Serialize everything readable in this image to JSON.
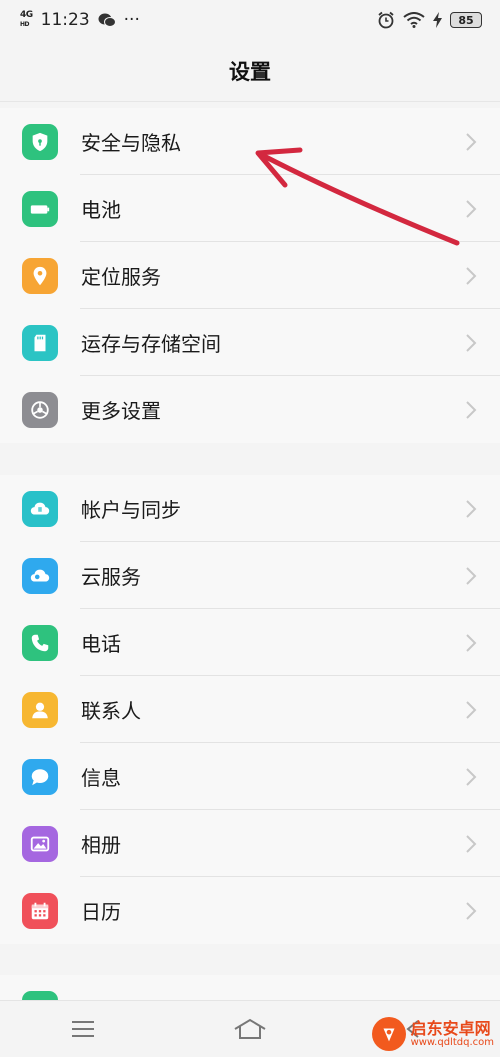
{
  "status_bar": {
    "network": "4G",
    "network_sub": "HD",
    "time": "11:23",
    "dots": "···",
    "battery": "85"
  },
  "header": {
    "title": "设置"
  },
  "groups": [
    {
      "items": [
        {
          "label": "安全与隐私",
          "icon": "shield-icon",
          "color": "#2ec27e"
        },
        {
          "label": "电池",
          "icon": "battery-icon",
          "color": "#2ec27e"
        },
        {
          "label": "定位服务",
          "icon": "location-icon",
          "color": "#f7a534"
        },
        {
          "label": "运存与存储空间",
          "icon": "sd-card-icon",
          "color": "#2bc4c4"
        },
        {
          "label": "更多设置",
          "icon": "gear-icon",
          "color": "#8d8d92"
        }
      ]
    },
    {
      "items": [
        {
          "label": "帐户与同步",
          "icon": "cloud-sync-icon",
          "color": "#29c1c9"
        },
        {
          "label": "云服务",
          "icon": "cloud-icon",
          "color": "#2fa9ee"
        },
        {
          "label": "电话",
          "icon": "phone-icon",
          "color": "#2ec27e"
        },
        {
          "label": "联系人",
          "icon": "contact-icon",
          "color": "#f7b731"
        },
        {
          "label": "信息",
          "icon": "message-icon",
          "color": "#2fa9ee"
        },
        {
          "label": "相册",
          "icon": "photo-icon",
          "color": "#a567e0"
        },
        {
          "label": "日历",
          "icon": "calendar-icon",
          "color": "#f0505a"
        }
      ]
    }
  ],
  "watermark": {
    "title": "启东安卓网",
    "url": "www.qdltdq.com"
  }
}
